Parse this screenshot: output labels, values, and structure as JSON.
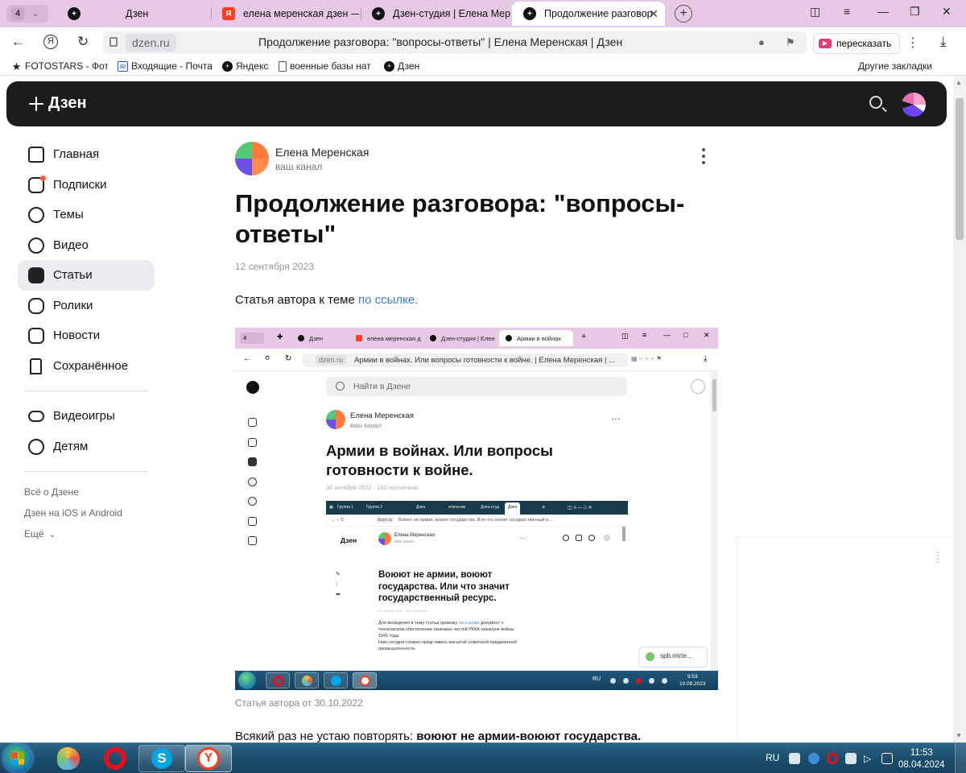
{
  "browser": {
    "tab_count": "4",
    "tabs": [
      {
        "title": "Дзен",
        "icon": "dzen-icon"
      },
      {
        "title": "елена меренская дзен — Я",
        "icon": "yandex-icon"
      },
      {
        "title": "Дзен-студия | Елена Мере",
        "icon": "dzen-icon"
      },
      {
        "title": "Продолжение разговор",
        "icon": "dzen-icon",
        "active": true
      }
    ],
    "domain": "dzen.ru",
    "page_title": "Продолжение разговора: \"вопросы-ответы\" | Елена Меренская | Дзен",
    "retell_label": "пересказать",
    "bookmarks": [
      {
        "label": "FOTOSTARS - Фото",
        "icon": "star-icon"
      },
      {
        "label": "Входящие - Почта",
        "icon": "mail-icon"
      },
      {
        "label": "Яндекс",
        "icon": "dzen-icon"
      },
      {
        "label": "военные базы нат",
        "icon": "page-icon"
      },
      {
        "label": "Дзен",
        "icon": "dzen-icon"
      }
    ],
    "other_bookmarks": "Другие закладки"
  },
  "header": {
    "logo": "Дзен"
  },
  "sidebar": {
    "items": [
      {
        "label": "Главная",
        "icon": "home-icon"
      },
      {
        "label": "Подписки",
        "icon": "subscriptions-icon"
      },
      {
        "label": "Темы",
        "icon": "compass-icon"
      },
      {
        "label": "Видео",
        "icon": "video-icon"
      },
      {
        "label": "Статьи",
        "icon": "articles-icon",
        "selected": true
      },
      {
        "label": "Ролики",
        "icon": "clips-icon"
      },
      {
        "label": "Новости",
        "icon": "news-icon"
      },
      {
        "label": "Сохранённое",
        "icon": "bookmark-icon"
      }
    ],
    "extra_items": [
      {
        "label": "Видеоигры",
        "icon": "gamepad-icon"
      },
      {
        "label": "Детям",
        "icon": "kids-icon"
      }
    ],
    "footer_links": [
      "Всё о Дзене",
      "Дзен на iOS и Android",
      "Ещё"
    ]
  },
  "article": {
    "author": "Елена Меренская",
    "author_sub": "ваш канал",
    "title": "Продолжение разговора: \"вопросы-ответы\"",
    "date": "12 сентября 2023",
    "intro_text": "Статья автора к теме ",
    "intro_link": "по ссылке.",
    "caption": "Статья автора от 30.10.2022",
    "para_text": "Всякий раз не устаю повторять: ",
    "para_bold": "воюют не армии-воюют государства."
  },
  "embedded": {
    "tab_count": "4",
    "tabs": [
      "Дзен",
      "елена меренская д",
      "Дзен-студия | Елен",
      "Армии в войнах"
    ],
    "domain": "dzen.ru",
    "page_title": "Армии в войнах. Или вопросы готовности к войне. | Елена Меренская | ...",
    "search_placeholder": "Найти в Дзене",
    "author": "Елена Меренская",
    "author_sub": "ваш канал",
    "title": "Армии в войнах. Или вопросы готовности к войне.",
    "meta": "30 октября 2022 · 100 прочитали",
    "popup": "spb.mirte...",
    "lang": "RU",
    "time": "9:53",
    "date": "10.09.2023",
    "inner": {
      "tabs": [
        "Группа 1",
        "Группа 2",
        "Дзен",
        "елена ме",
        "Дзен-студ",
        "Дзен"
      ],
      "domain": "dzen.ru",
      "page_title": "Воюют не армии, воюют государства. Или что значит государственный р...",
      "logo": "Дзен",
      "author": "Елена Меренская",
      "author_sub": "ваш канал",
      "title": "Воюют не армии, воюют государства. Или что значит государственный ресурс.",
      "meta": "26 октября 2022 · 108 прочитали",
      "para1_a": "Для вхождения в тему статьи привожу ",
      "para1_link": "по ссылке",
      "para1_b": " документ о техническом обеспечении танковых частей РККА накануне войны 1941 года.",
      "para2": "Нам сегодня сложно представить масштаб советской предвоенной промышленности."
    }
  },
  "taskbar": {
    "lang": "RU",
    "time": "11:53",
    "date": "08.04.2024"
  }
}
